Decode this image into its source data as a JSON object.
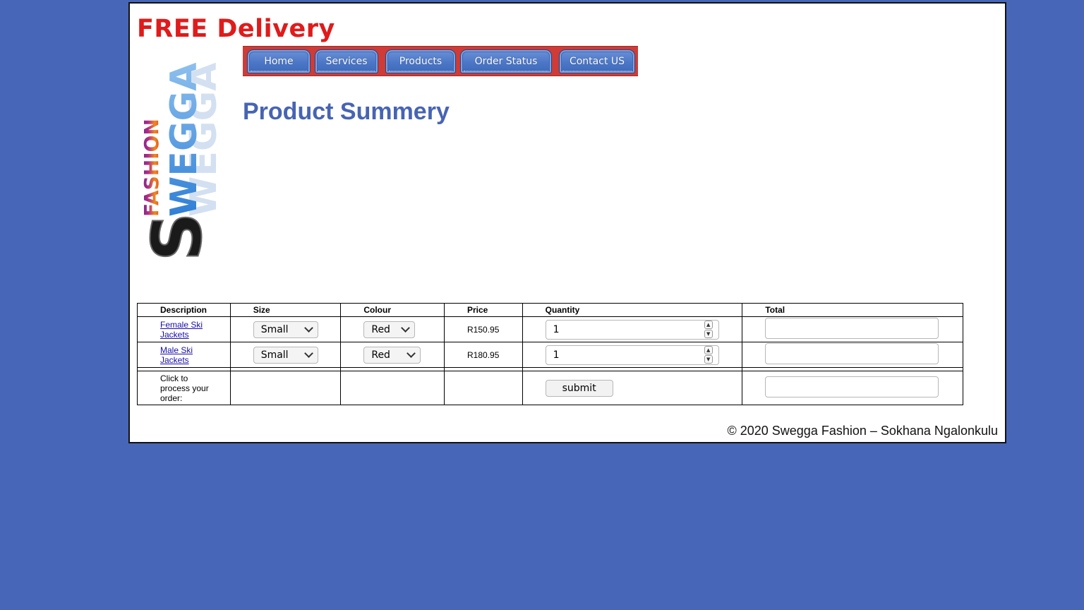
{
  "promo": {
    "text": "FREE Delivery"
  },
  "logo": {
    "word_small": "FASHION",
    "word_big": "WEGGA",
    "initial": "S"
  },
  "nav": {
    "items": [
      {
        "label": "Home"
      },
      {
        "label": "Services"
      },
      {
        "label": "Products"
      },
      {
        "label": "Order Status"
      },
      {
        "label": "Contact US"
      }
    ]
  },
  "page": {
    "title": "Product Summery"
  },
  "table": {
    "headers": {
      "description": "Description",
      "size": "Size",
      "colour": "Colour",
      "price": "Price",
      "quantity": "Quantity",
      "total": "Total"
    },
    "rows": [
      {
        "description": "Female Ski Jackets",
        "size": "Small",
        "colour": "Red",
        "price": "R150.95",
        "quantity": "1",
        "total": ""
      },
      {
        "description": "Male Ski Jackets",
        "size": "Small",
        "colour": "Red",
        "price": "R180.95",
        "quantity": "1",
        "total": ""
      }
    ],
    "submit_row": {
      "label": "Click to process your order:",
      "button": "submit",
      "total": ""
    }
  },
  "footer": {
    "text": "© 2020 Swegga Fashion – Sokhana Ngalonkulu"
  },
  "colors": {
    "background": "#4866b7",
    "promo": "#e01b1b",
    "title": "#4764b3",
    "nav_bar": "#cf3b36",
    "nav_button": "#4c77c7"
  }
}
